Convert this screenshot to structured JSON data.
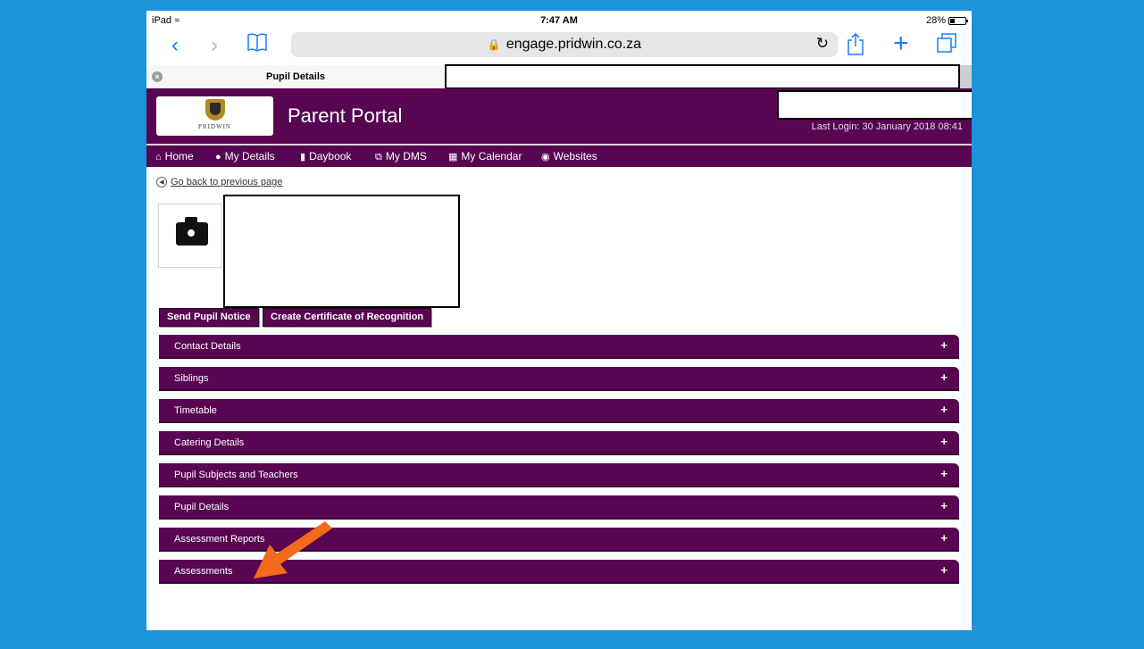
{
  "status": {
    "device": "iPad",
    "time": "7:47 AM",
    "battery": "28%"
  },
  "browser": {
    "url": "engage.pridwin.co.za",
    "tab_title": "Pupil Details"
  },
  "portal": {
    "logo_text": "PRIDWIN",
    "title": "Parent Portal",
    "last_login": "Last Login: 30 January 2018 08:41"
  },
  "nav": [
    {
      "label": "Home",
      "icon": "home-icon"
    },
    {
      "label": "My Details",
      "icon": "user-icon"
    },
    {
      "label": "Daybook",
      "icon": "book-icon"
    },
    {
      "label": "My DMS",
      "icon": "documents-icon"
    },
    {
      "label": "My Calendar",
      "icon": "calendar-icon"
    },
    {
      "label": "Websites",
      "icon": "globe-icon"
    }
  ],
  "content": {
    "back_link": "Go back to previous page",
    "buttons": {
      "send_notice": "Send Pupil Notice",
      "certificate": "Create Certificate of Recognition"
    },
    "sections": [
      {
        "label": "Contact Details"
      },
      {
        "label": "Siblings"
      },
      {
        "label": "Timetable"
      },
      {
        "label": "Catering Details"
      },
      {
        "label": "Pupil Subjects and Teachers"
      },
      {
        "label": "Pupil Details"
      },
      {
        "label": "Assessment Reports"
      },
      {
        "label": "Assessments"
      }
    ],
    "expand_symbol": "+"
  },
  "colors": {
    "brand": "#580552",
    "background": "#1b94dc",
    "annotation_arrow": "#f26a1b"
  }
}
